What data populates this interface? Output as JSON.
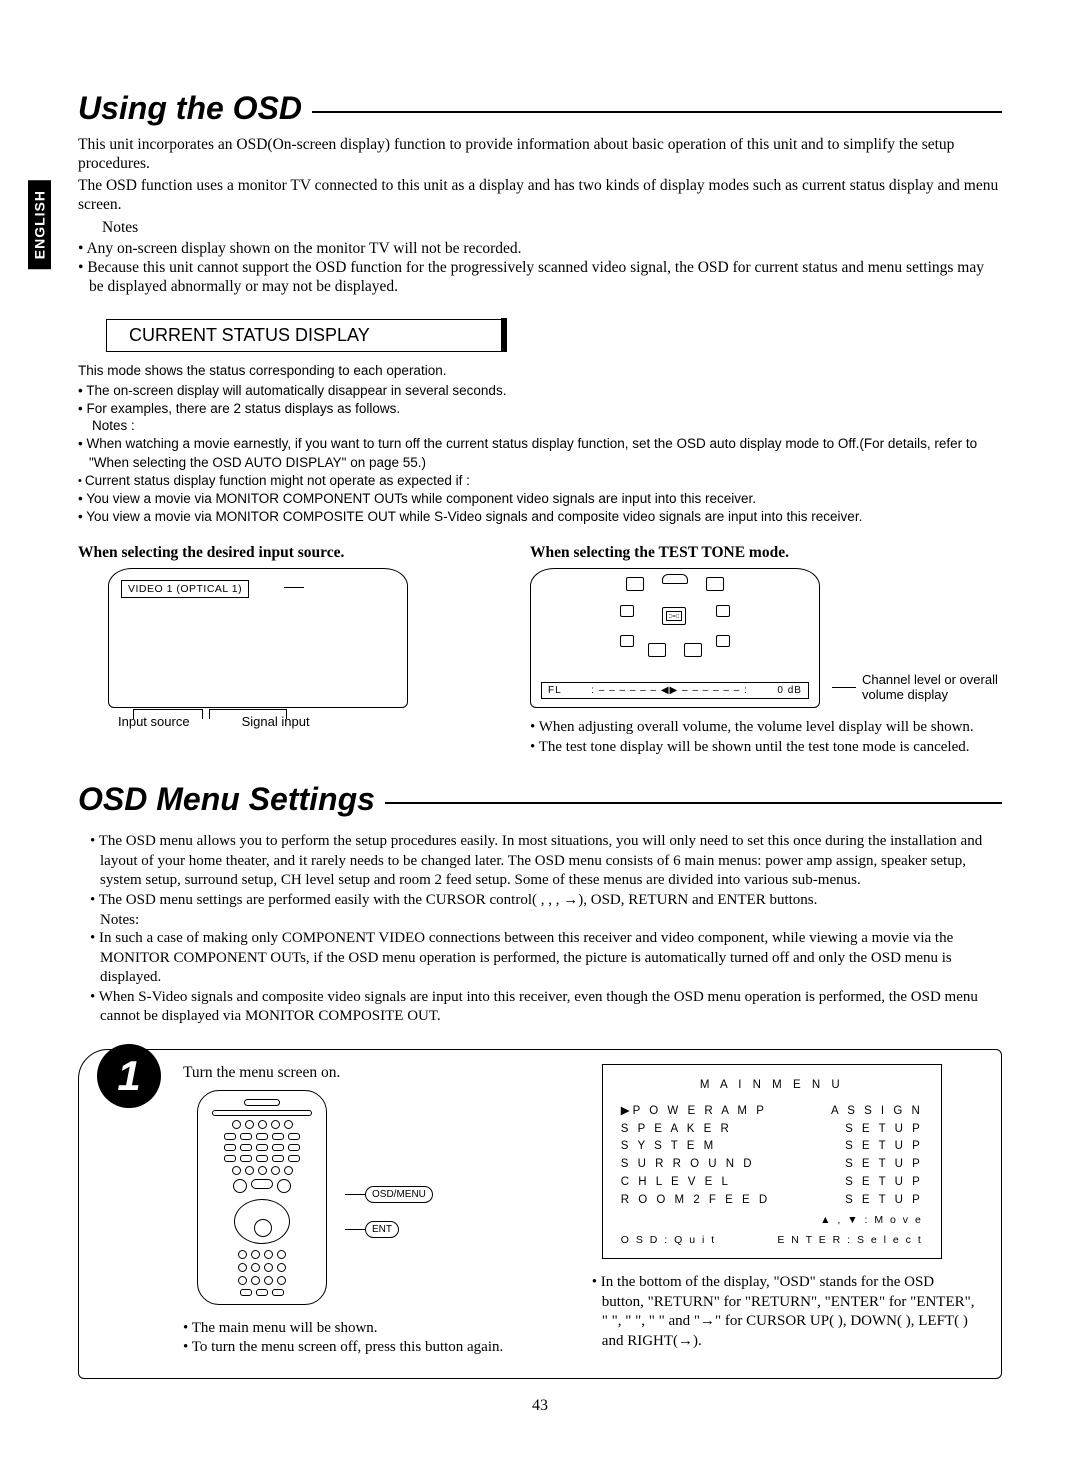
{
  "lang_tab": "ENGLISH",
  "page_number": "43",
  "section1": {
    "title": "Using the OSD",
    "p1": "This unit incorporates an OSD(On-screen display) function to provide information about basic operation of this unit and to simplify the setup procedures.",
    "p2": "The OSD function uses a monitor TV connected to this unit as a display and has two kinds of display modes such as current status display and menu screen.",
    "notes_label": "Notes",
    "n1": "Any on-screen display shown on the monitor TV will not be recorded.",
    "n2": "Because this unit cannot support the OSD function for the progressively scanned video signal, the OSD for current status and menu settings may be displayed abnormally or may not be displayed."
  },
  "current_status": {
    "heading": "CURRENT STATUS DISPLAY",
    "p1": "This mode shows the status corresponding to each operation.",
    "b1": "The on-screen display will automatically disappear in several seconds.",
    "b2": "For examples, there are 2 status displays as follows.",
    "notes_label": "Notes :",
    "b3": "When watching a movie earnestly, if you want to turn off the current status display function, set the OSD auto display mode to Off.(For details, refer to \"When selecting the OSD AUTO DISPLAY\" on page 55.)",
    "sq1": "Current status display function might not operate as expected if :",
    "b4": "You view a movie via MONITOR COMPONENT OUTs while component video signals are input into this receiver.",
    "b5": "You view a movie via MONITOR COMPOSITE OUT while S-Video signals and composite video signals are input into this receiver."
  },
  "left_example": {
    "title": "When selecting the desired input source.",
    "osd_text": "VIDEO 1  (OPTICAL  1)",
    "label_input": "Input source",
    "label_signal": "Signal input"
  },
  "right_example": {
    "title": "When selecting the TEST TONE mode.",
    "fl_label": "FL",
    "fl_value": "0 dB",
    "ch_label": "Channel level or overall volume display",
    "b1": "When adjusting overall volume, the volume level display will be shown.",
    "b2": "The test tone display will be shown until the test tone mode is canceled."
  },
  "section2": {
    "title": "OSD Menu Settings",
    "b1": "The OSD menu allows you to perform the setup procedures easily. In most situations, you will only need to set this once during the installation and layout of your home theater, and it rarely needs to be changed later. The OSD menu consists of 6 main menus: power amp assign, speaker setup, system setup, surround setup, CH  level setup and room 2 feed setup. Some of these menus are divided into various sub-menus.",
    "b2": "The OSD menu settings are performed easily with the CURSOR control(   ,    ,    , →), OSD, RETURN and ENTER buttons.",
    "notes_label": "Notes:",
    "b3": "In such a case of making only COMPONENT VIDEO connections between this receiver and video component, while viewing a movie via the MONITOR COMPONENT OUTs, if the OSD menu operation is performed, the picture is automatically turned off and only the OSD menu is displayed.",
    "b4": "When S-Video signals and composite video signals are input into this receiver, even though the OSD menu operation is performed, the OSD menu cannot be displayed via MONITOR COMPOSITE OUT."
  },
  "step1": {
    "num": "1",
    "instr": "Turn the menu screen on.",
    "callout1": "OSD/MENU",
    "callout2": "ENT",
    "lb1": "The main menu will be shown.",
    "lb2": "To turn the menu screen off, press this button again.",
    "menu": {
      "title": "M A I N    M E N U",
      "items": [
        {
          "l": "▶P O W E R   A M P",
          "r": "A S S I G N"
        },
        {
          "l": "  S P E A K E R",
          "r": "S E T U P"
        },
        {
          "l": "  S Y S T E M",
          "r": "S E T U P"
        },
        {
          "l": "  S U R R O U N D",
          "r": "S E T U P"
        },
        {
          "l": "  C H   L E V E L",
          "r": "S E T U P"
        },
        {
          "l": "  R O O M 2   F E E D",
          "r": "S E T U P"
        }
      ],
      "hint_move": "▲ , ▼ : M o v e",
      "hint_quit": "O S D : Q u i t",
      "hint_enter": "E N T E R : S e l e c t"
    },
    "rb1": "In the bottom of the display, \"OSD\" stands for the OSD button, \"RETURN\" for \"RETURN\", \"ENTER\" for \"ENTER\", \"   \", \"   \", \"   \" and \"→\" for CURSOR UP(   ), DOWN(   ), LEFT(   ) and RIGHT(→)."
  }
}
